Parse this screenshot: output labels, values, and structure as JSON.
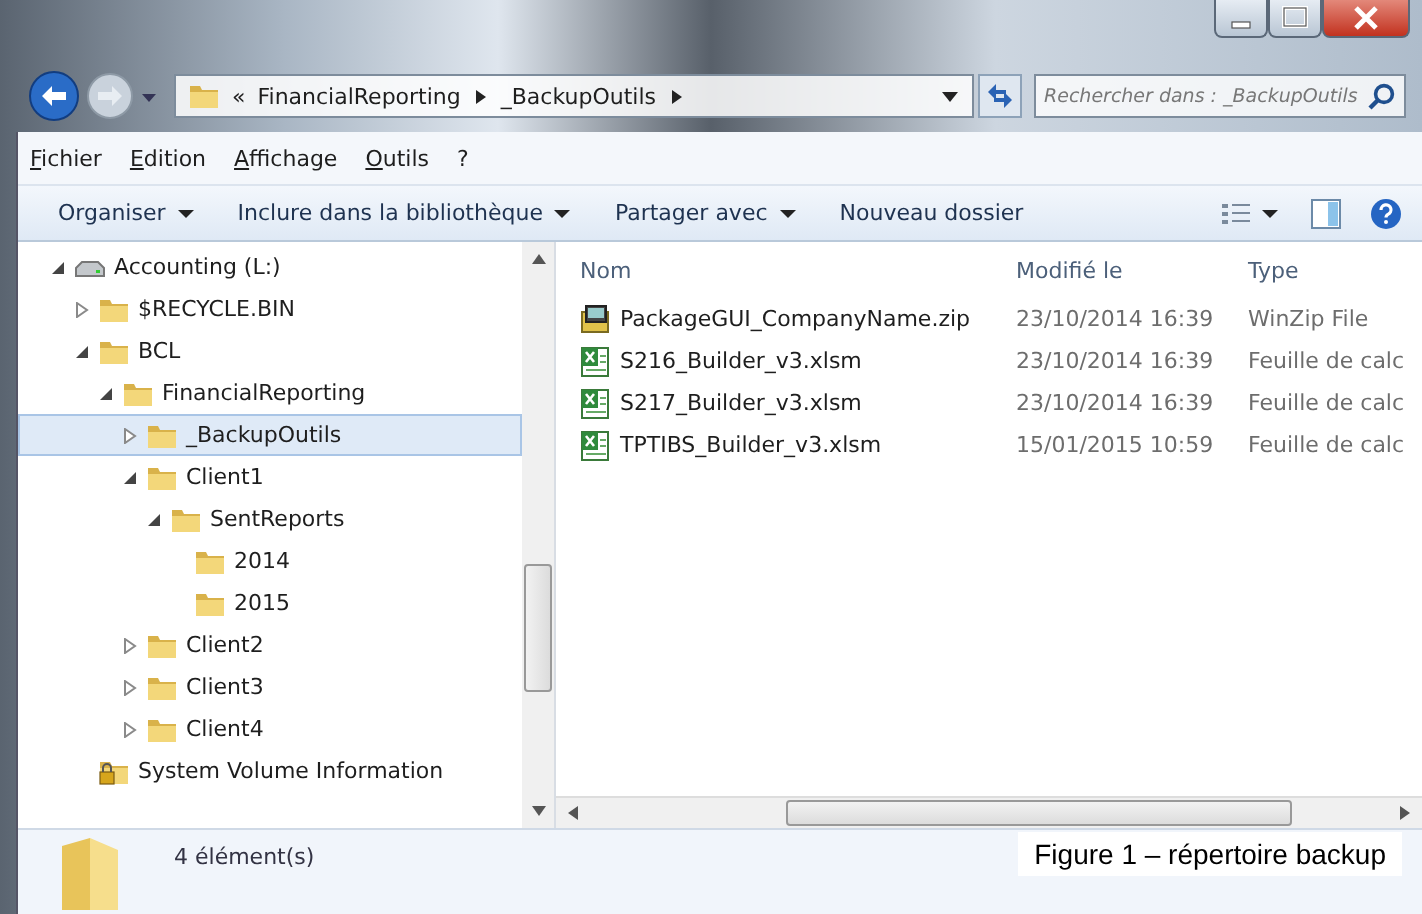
{
  "address_bar": {
    "overflow": "«",
    "path": [
      "FinancialReporting",
      "_BackupOutils"
    ]
  },
  "search": {
    "placeholder": "Rechercher dans : _BackupOutils"
  },
  "menu": [
    "Fichier",
    "Edition",
    "Affichage",
    "Outils",
    "?"
  ],
  "toolbar": [
    {
      "label": "Organiser",
      "dropdown": true
    },
    {
      "label": "Inclure dans la bibliothèque",
      "dropdown": true
    },
    {
      "label": "Partager avec",
      "dropdown": true
    },
    {
      "label": "Nouveau dossier",
      "dropdown": false
    }
  ],
  "tree": [
    {
      "label": "Accounting (L:)",
      "kind": "drive",
      "expanded": true,
      "selected": false,
      "children": [
        {
          "label": "$RECYCLE.BIN",
          "kind": "folder",
          "expanded": false,
          "selected": false
        },
        {
          "label": "BCL",
          "kind": "folder",
          "expanded": true,
          "selected": false,
          "children": [
            {
              "label": "FinancialReporting",
              "kind": "folder",
              "expanded": true,
              "selected": false,
              "children": [
                {
                  "label": "_BackupOutils",
                  "kind": "folder",
                  "expanded": false,
                  "selected": true
                },
                {
                  "label": "Client1",
                  "kind": "folder",
                  "expanded": true,
                  "selected": false,
                  "children": [
                    {
                      "label": "SentReports",
                      "kind": "folder",
                      "expanded": true,
                      "selected": false,
                      "children": [
                        {
                          "label": "2014",
                          "kind": "folder",
                          "selected": false
                        },
                        {
                          "label": "2015",
                          "kind": "folder",
                          "selected": false
                        }
                      ]
                    }
                  ]
                },
                {
                  "label": "Client2",
                  "kind": "folder",
                  "expanded": false,
                  "selected": false
                },
                {
                  "label": "Client3",
                  "kind": "folder",
                  "expanded": false,
                  "selected": false
                },
                {
                  "label": "Client4",
                  "kind": "folder",
                  "expanded": false,
                  "selected": false
                }
              ]
            }
          ]
        },
        {
          "label": "System Volume Information",
          "kind": "locked-folder",
          "selected": false
        }
      ]
    }
  ],
  "table": {
    "columns": [
      "Nom",
      "Modifié le",
      "Type"
    ],
    "rows": [
      {
        "kind": "zip",
        "name": "PackageGUI_CompanyName.zip",
        "modified": "23/10/2014 16:39",
        "type": "WinZip File"
      },
      {
        "kind": "excel",
        "name": "S216_Builder_v3.xlsm",
        "modified": "23/10/2014 16:39",
        "type": "Feuille de calc"
      },
      {
        "kind": "excel",
        "name": "S217_Builder_v3.xlsm",
        "modified": "23/10/2014 16:39",
        "type": "Feuille de calc"
      },
      {
        "kind": "excel",
        "name": "TPTIBS_Builder_v3.xlsm",
        "modified": "15/01/2015 10:59",
        "type": "Feuille de calc"
      }
    ]
  },
  "status_bar": {
    "count": "4 élément(s)"
  },
  "caption": "Figure 1 – répertoire backup"
}
